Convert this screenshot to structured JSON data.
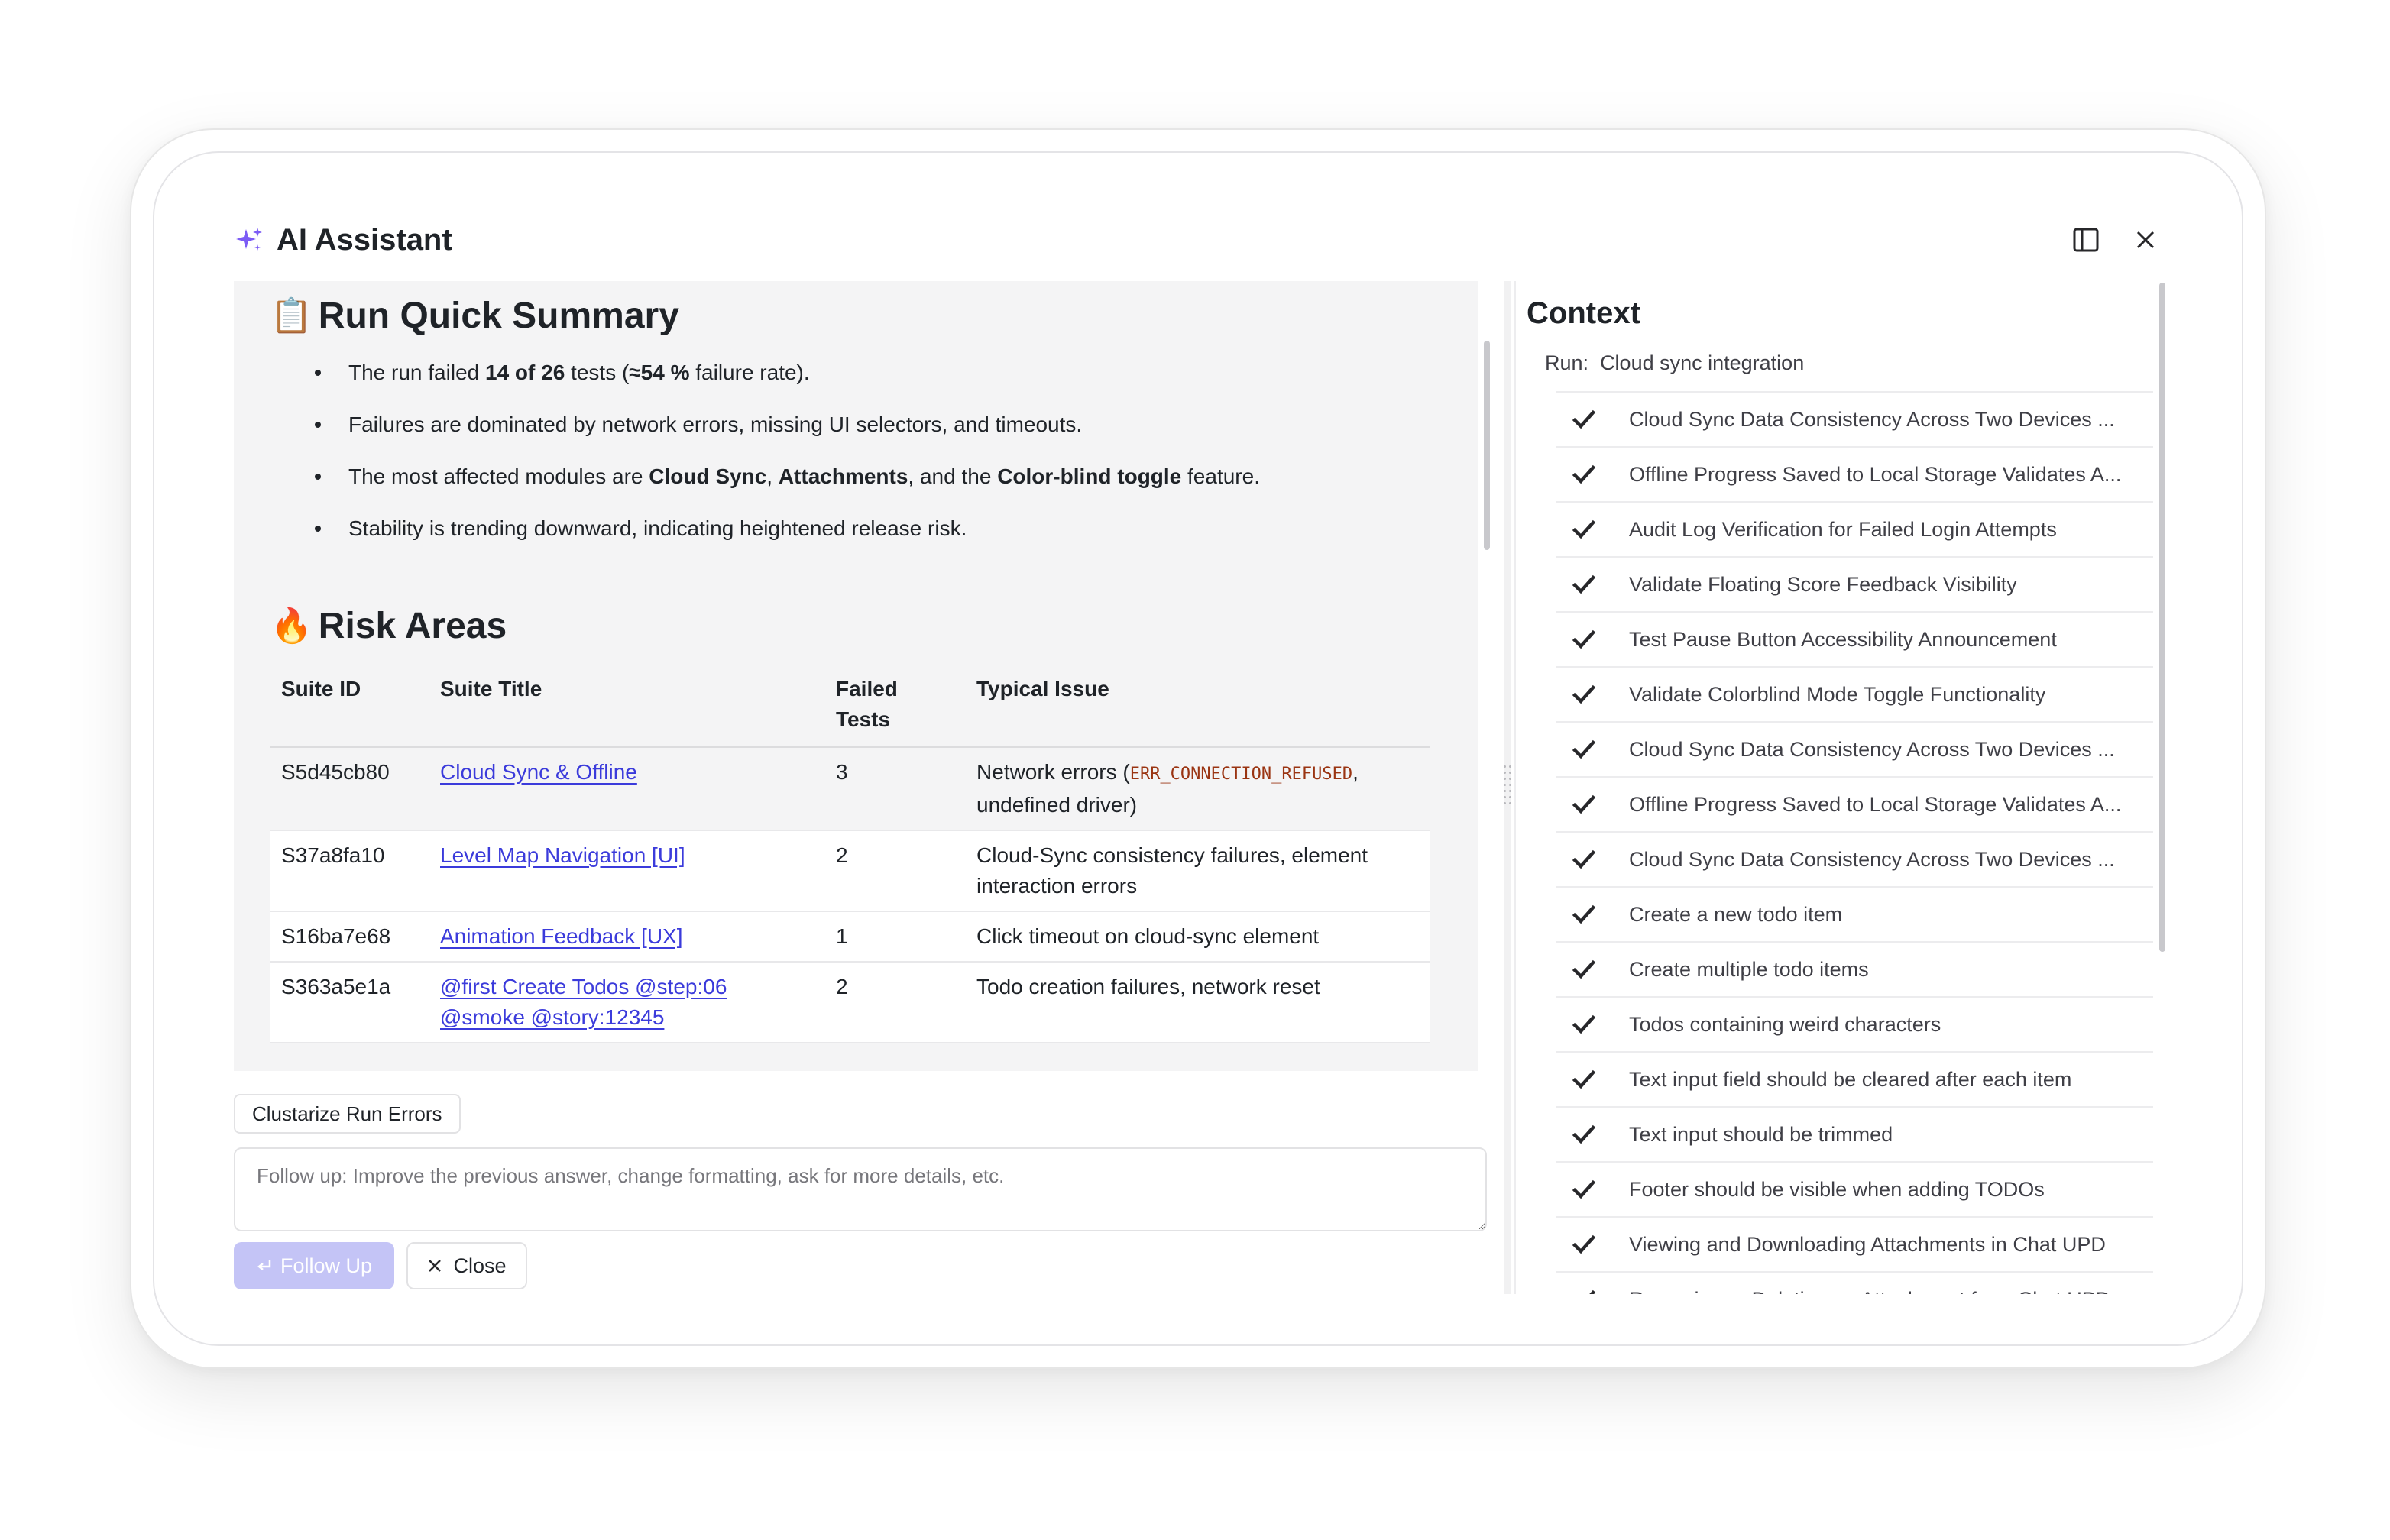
{
  "header": {
    "title": "AI Assistant",
    "icons": {
      "sparkle": "sparkle-icon",
      "sidebar": "sidebar-toggle-icon",
      "close": "close-icon"
    }
  },
  "summary": {
    "emoji": "📋",
    "title": "Run Quick Summary",
    "bullet1": {
      "p1": "The run failed ",
      "b1": "14 of 26",
      "p2": " tests (",
      "b2": "≈54 %",
      "p3": " failure rate)."
    },
    "bullet2": "Failures are dominated by network errors, missing UI selectors, and timeouts.",
    "bullet3": {
      "p1": "The most affected modules are ",
      "b1": "Cloud Sync",
      "p2": ", ",
      "b2": "Attachments",
      "p3": ", and the ",
      "b3": "Color-blind toggle",
      "p4": " feature."
    },
    "bullet4": "Stability is trending downward, indicating heightened release risk."
  },
  "risk": {
    "emoji": "🔥",
    "title": "Risk Areas",
    "columns": {
      "id": "Suite ID",
      "title": "Suite Title",
      "failed_line1": "Failed",
      "failed_line2": "Tests",
      "issue": "Typical Issue"
    },
    "rows": [
      {
        "id": "S5d45cb80",
        "title": "Cloud Sync & Offline",
        "failed": "3",
        "issue_pre": "Network errors (",
        "issue_code": "ERR_CONNECTION_REFUSED",
        "issue_post": ", undefined driver)"
      },
      {
        "id": "S37a8fa10",
        "title": "Level Map Navigation [UI]",
        "failed": "2",
        "issue": "Cloud-Sync consistency failures, element interaction errors"
      },
      {
        "id": "S16ba7e68",
        "title": "Animation Feedback [UX]",
        "failed": "1",
        "issue": "Click timeout on cloud-sync element"
      },
      {
        "id": "S363a5e1a",
        "title_line1": "@first Create Todos @step:06",
        "title_line2": "@smoke @story:12345",
        "failed": "2",
        "issue": "Todo creation failures, network reset"
      }
    ]
  },
  "actions": {
    "clusterize": "Clustarize Run Errors",
    "followup_placeholder": "Follow up: Improve the previous answer, change formatting, ask for more details, etc.",
    "followup_button": "Follow Up",
    "close_button": "Close"
  },
  "context": {
    "title": "Context",
    "run_label": "Run:",
    "run_name": "Cloud sync integration",
    "items": [
      "Cloud Sync Data Consistency Across Two Devices ...",
      "Offline Progress Saved to Local Storage Validates A...",
      "Audit Log Verification for Failed Login Attempts",
      "Validate Floating Score Feedback Visibility",
      "Test Pause Button Accessibility Announcement",
      "Validate Colorblind Mode Toggle Functionality",
      "Cloud Sync Data Consistency Across Two Devices ...",
      "Offline Progress Saved to Local Storage Validates A...",
      "Cloud Sync Data Consistency Across Two Devices ...",
      "Create a new todo item",
      "Create multiple todo items",
      "Todos containing weird characters",
      "Text input field should be cleared after each item",
      "Text input should be trimmed",
      "Footer should be visible when adding TODOs",
      "Viewing and Downloading Attachments in Chat UPD",
      "Removing or Deleting an Attachment from Chat UPD"
    ]
  }
}
